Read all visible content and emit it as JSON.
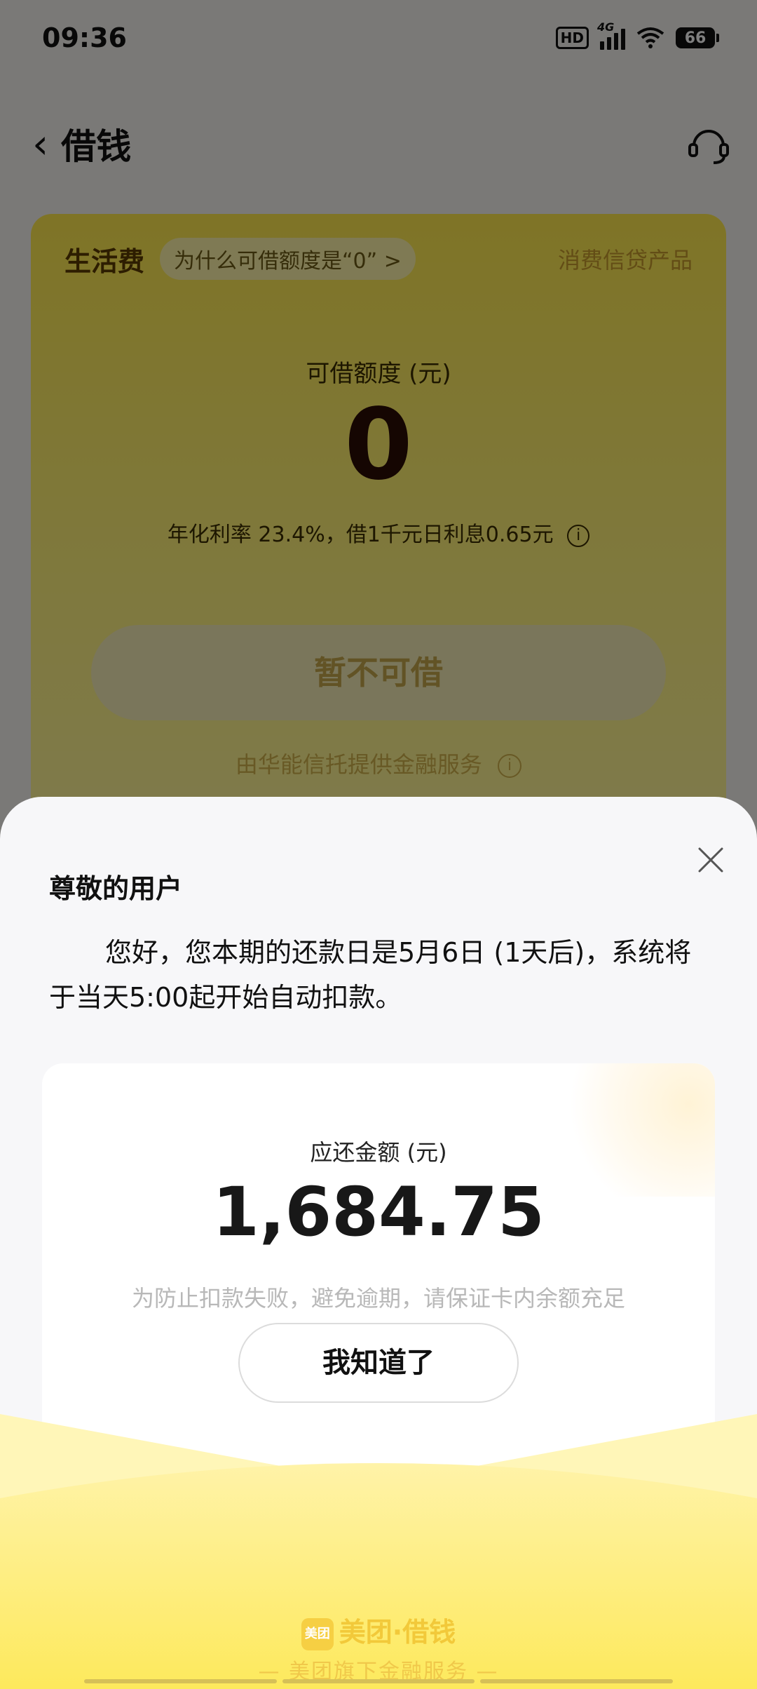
{
  "status_bar": {
    "time": "09:36",
    "hd": "HD",
    "network": "4G",
    "battery": "66"
  },
  "nav": {
    "back_icon": "chevron-left-icon",
    "title": "借钱",
    "service_icon": "headset-icon"
  },
  "loan_card": {
    "tag": "生活费",
    "why_link": "为什么可借额度是“0” >",
    "product_type": "消费信贷产品",
    "limit_label": "可借额度 (元)",
    "limit_value": "0",
    "rate_text": "年化利率 23.4%，借1千元日利息0.65元",
    "info_icon": "i",
    "borrow_button": "暂不可借",
    "provider_text": "由华能信托提供金融服务"
  },
  "sheet": {
    "close_icon": "close-icon",
    "title": "尊敬的用户",
    "message": "您好，您本期的还款日是5月6日 (1天后)，系统将于当天5:00起开始自动扣款。",
    "amount_label": "应还金额 (元)",
    "amount_value": "1,684.75",
    "hint": "为防止扣款失败，避免逾期，请保证卡内余额充足",
    "ack_button": "我知道了",
    "brand_logo_text": "美团",
    "brand": "美团·借钱",
    "brand_sub": "— 美团旗下金融服务 —"
  },
  "colors": {
    "card_yellow": "#ffe94d",
    "footer_yellow": "#fde95c",
    "scrim": "rgba(0,0,0,0.5)"
  }
}
